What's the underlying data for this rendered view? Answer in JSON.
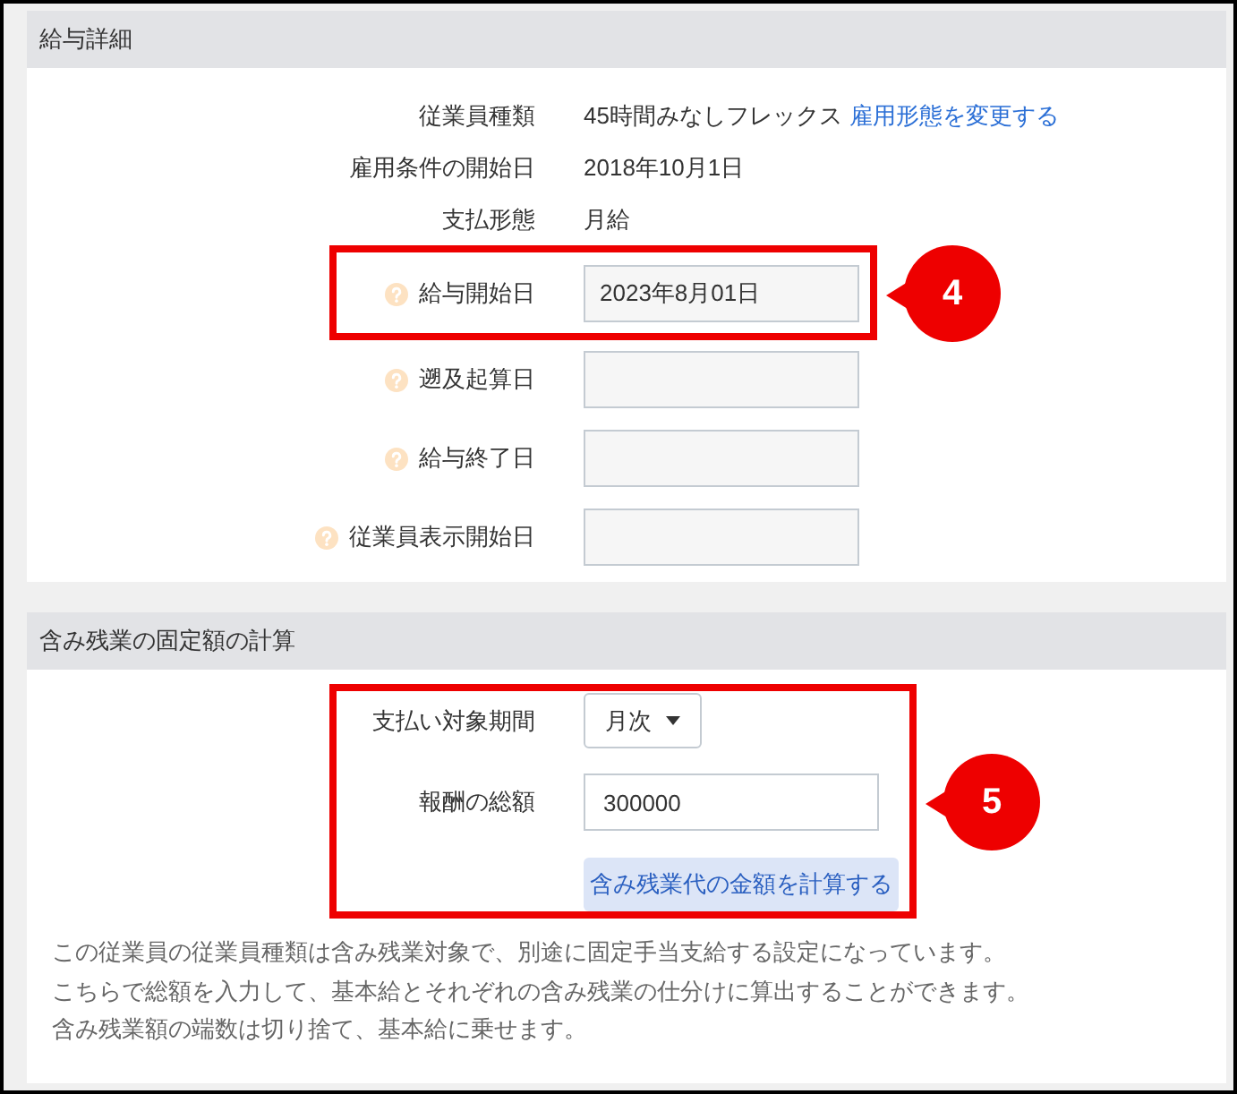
{
  "sections": [
    {
      "title": "給与詳細",
      "groups": [
        {
          "rows": [
            {
              "kind": "text",
              "label": "従業員種類",
              "help": false,
              "value": "45時間みなしフレックス",
              "link": "雇用形態を変更する"
            },
            {
              "kind": "text",
              "label": "雇用条件の開始日",
              "help": false,
              "value": "2018年10月1日"
            },
            {
              "kind": "text",
              "label": "支払形態",
              "help": false,
              "value": "月給"
            }
          ]
        },
        {
          "callout": "4",
          "rows": [
            {
              "kind": "date",
              "label": "給与開始日",
              "help": true,
              "value": "2023年8月01日"
            }
          ]
        },
        {
          "rows": [
            {
              "kind": "date",
              "label": "遡及起算日",
              "help": true
            },
            {
              "kind": "date",
              "label": "給与終了日",
              "help": true
            },
            {
              "kind": "date",
              "label": "従業員表示開始日",
              "help": true
            }
          ]
        }
      ]
    },
    {
      "title": "含み残業の固定額の計算",
      "groups": [
        {
          "callout": "5",
          "rows": [
            {
              "kind": "select",
              "label": "支払い対象期間",
              "help": false,
              "value": "月次"
            },
            {
              "kind": "input",
              "label": "報酬の総額",
              "help": false,
              "value": "300000"
            },
            {
              "kind": "button",
              "label": "含み残業代の金額を計算する"
            }
          ]
        }
      ],
      "note": [
        "この従業員の従業員種類は含み残業対象で、別途に固定手当支給する設定になっています。",
        "こちらで総額を入力して、基本給とそれぞれの含み残業の仕分けに算出することができます。",
        "含み残業額の端数は切り捨て、基本給に乗せます。"
      ]
    }
  ]
}
